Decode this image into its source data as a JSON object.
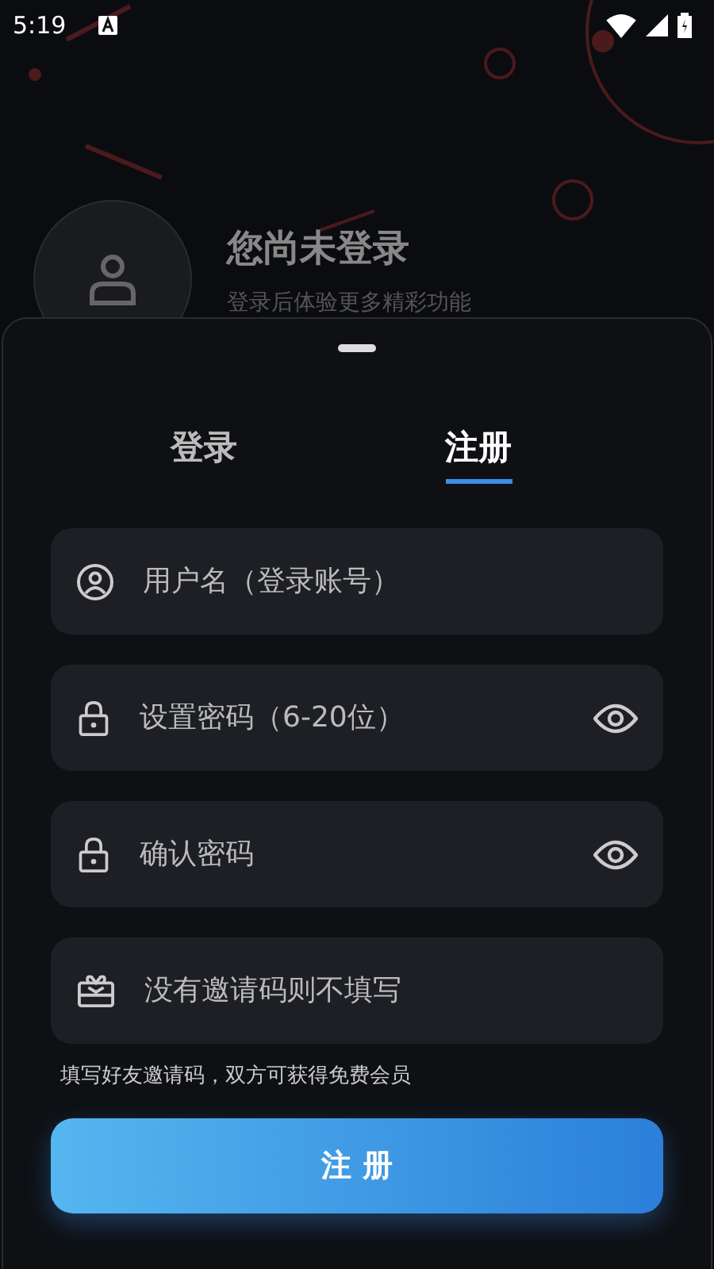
{
  "status_bar": {
    "time": "5:19"
  },
  "profile": {
    "title": "您尚未登录",
    "subtitle": "登录后体验更多精彩功能"
  },
  "tabs": [
    {
      "label": "登录",
      "selected": false
    },
    {
      "label": "注册",
      "selected": true
    }
  ],
  "fields": [
    {
      "kind": "username",
      "placeholder": "用户名（登录账号）",
      "reveal_toggle": false
    },
    {
      "kind": "password",
      "placeholder": "设置密码（6-20位）",
      "reveal_toggle": true
    },
    {
      "kind": "password",
      "placeholder": "确认密码",
      "reveal_toggle": true
    },
    {
      "kind": "invite",
      "placeholder": "没有邀请码则不填写",
      "reveal_toggle": false
    }
  ],
  "hint": "填写好友邀请码，双方可获得免费会员",
  "submit_button": "注 册"
}
